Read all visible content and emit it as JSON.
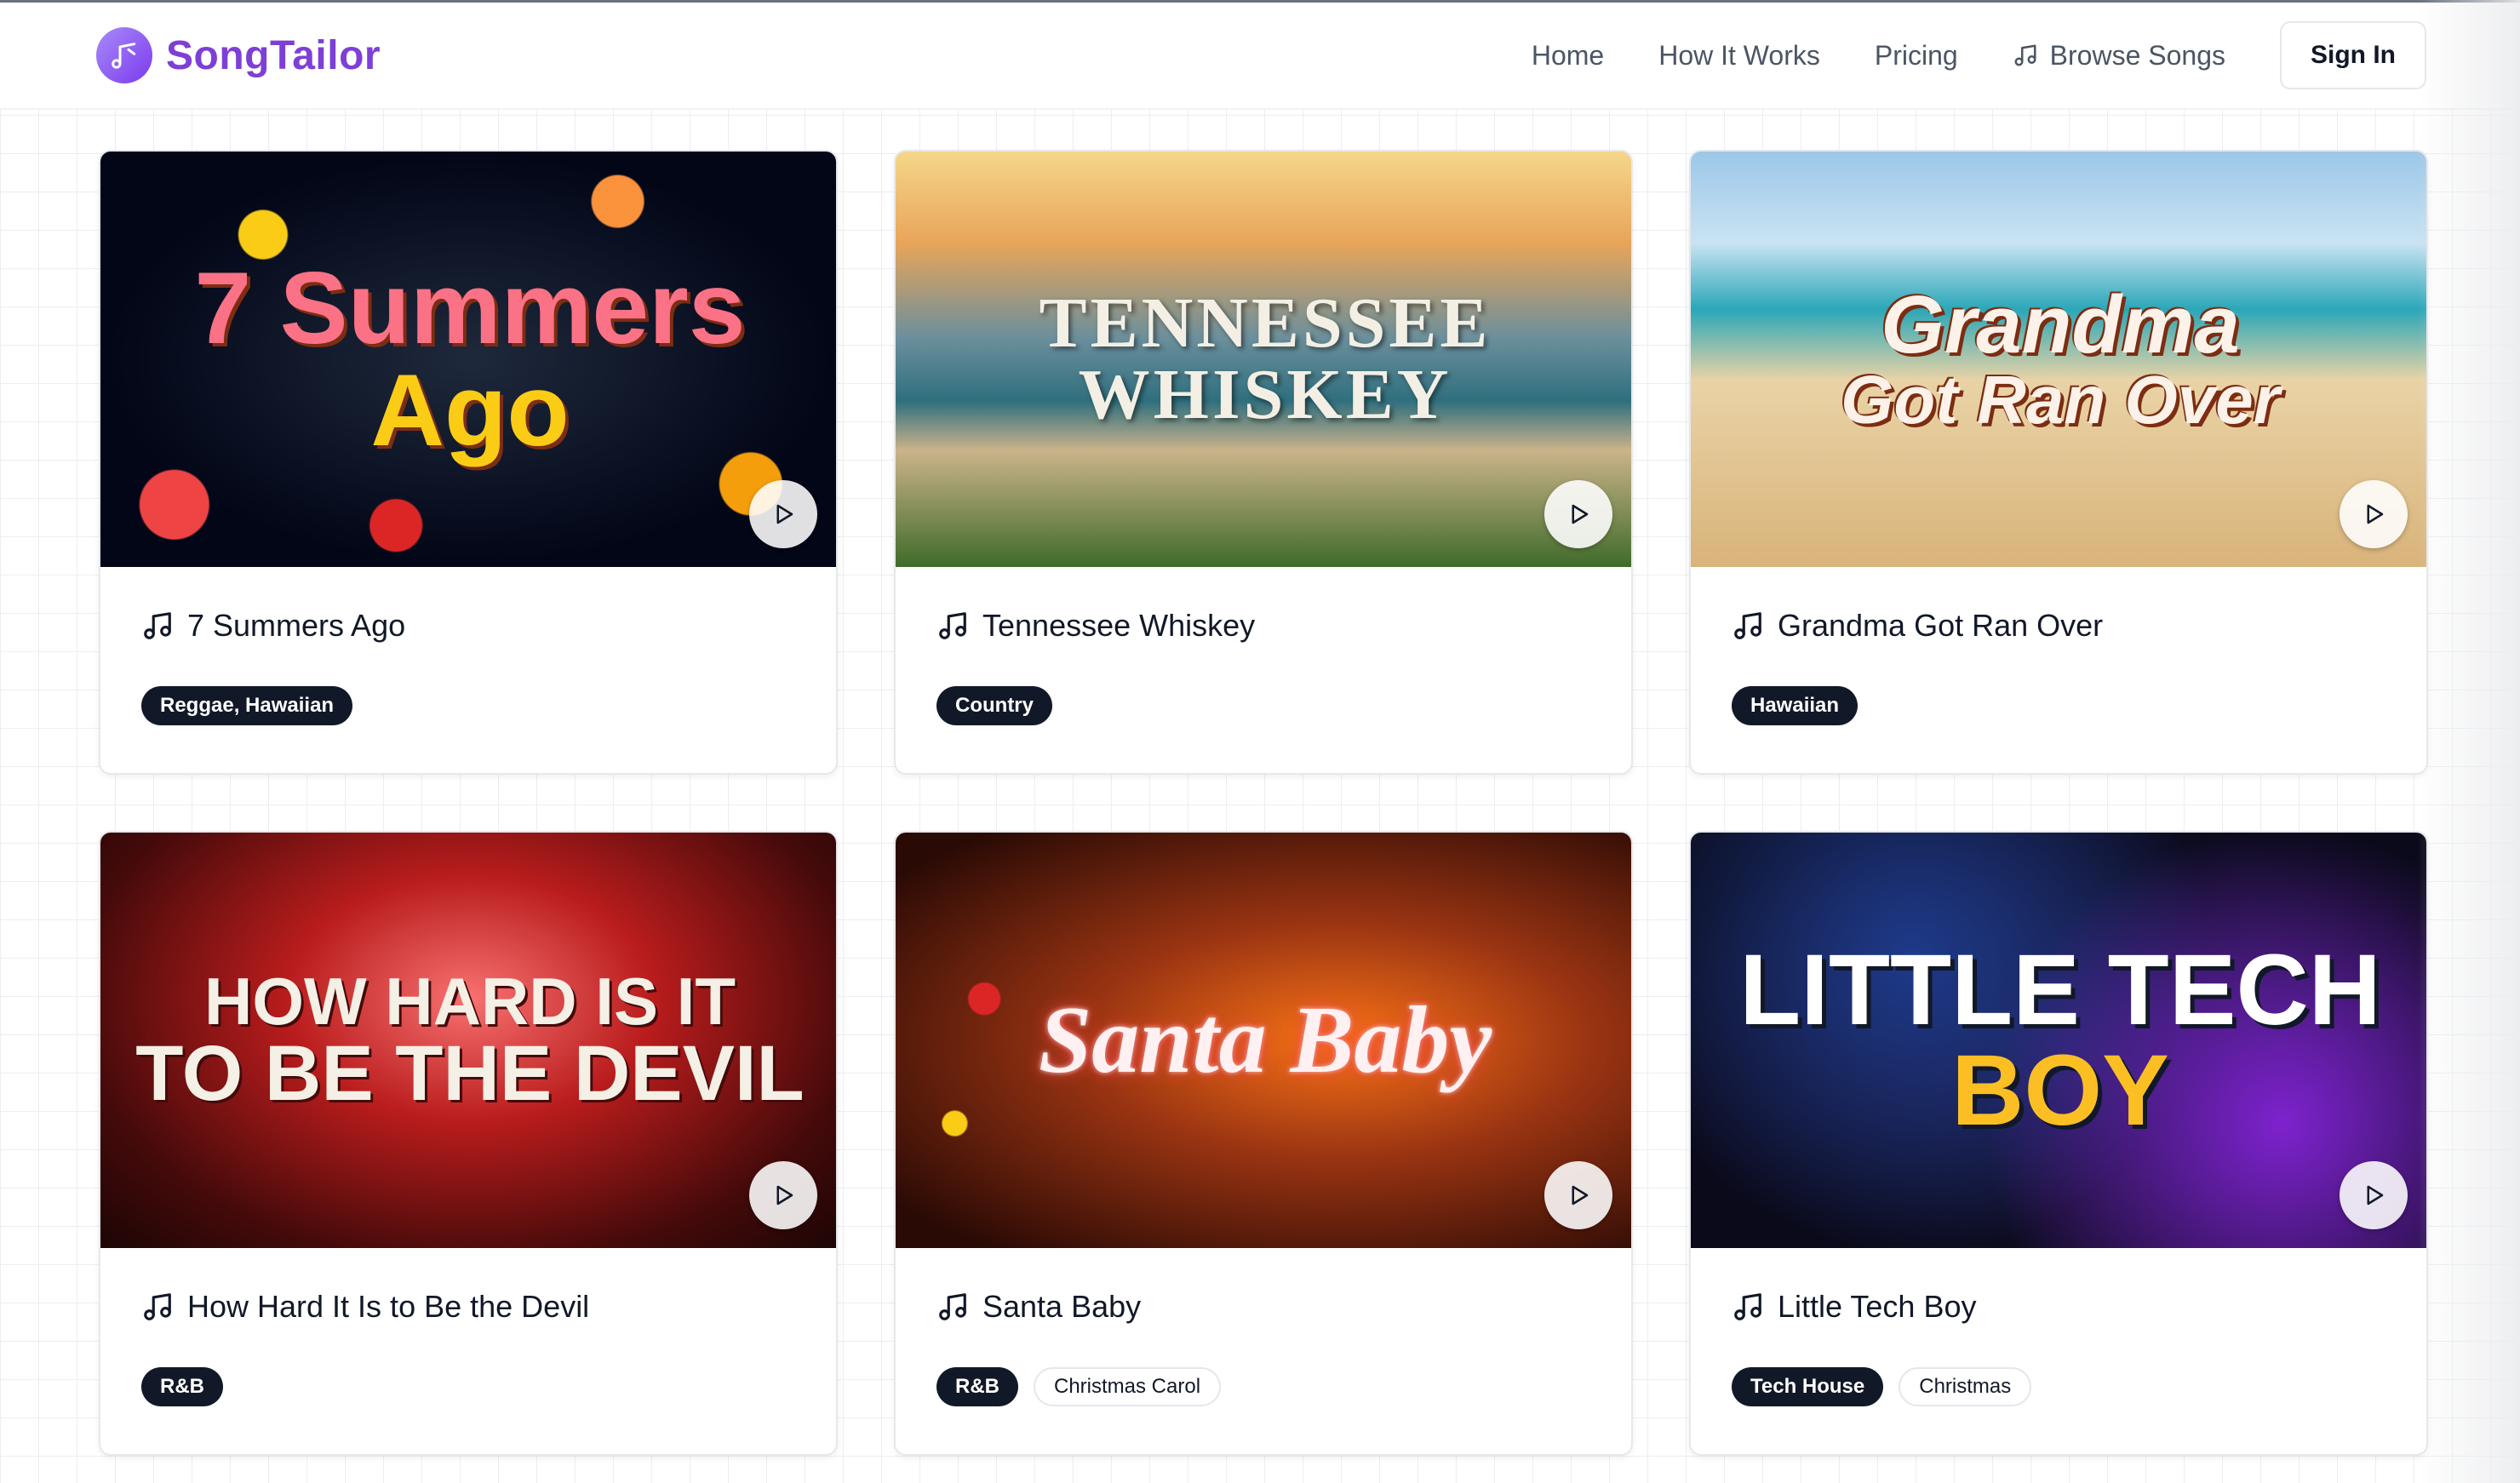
{
  "app": {
    "name": "SongTailor",
    "accent": "#7e3fd6"
  },
  "nav": {
    "items": [
      {
        "label": "Home",
        "icon": ""
      },
      {
        "label": "How It Works",
        "icon": ""
      },
      {
        "label": "Pricing",
        "icon": ""
      },
      {
        "label": "Browse Songs",
        "icon": "music-note-icon"
      }
    ],
    "sign_in_label": "Sign In"
  },
  "songs": [
    {
      "title": "7 Summers Ago",
      "cover_text_1": "7 Summers",
      "cover_text_2": "Ago",
      "tags": [
        {
          "label": "Reggae, Hawaiian",
          "style": "filled"
        }
      ]
    },
    {
      "title": "Tennessee Whiskey",
      "cover_text_1": "TENNESSEE",
      "cover_text_2": "WHISKEY",
      "tags": [
        {
          "label": "Country",
          "style": "filled"
        }
      ]
    },
    {
      "title": "Grandma Got Ran Over",
      "cover_text_1": "Grandma",
      "cover_text_2": "Got Ran Over",
      "tags": [
        {
          "label": "Hawaiian",
          "style": "filled"
        }
      ]
    },
    {
      "title": "How Hard It Is to Be the Devil",
      "cover_text_1": "HOW HARD IS IT",
      "cover_text_2": "TO BE THE DEVIL",
      "tags": [
        {
          "label": "R&B",
          "style": "filled"
        }
      ]
    },
    {
      "title": "Santa Baby",
      "cover_text_1": "Santa Baby",
      "cover_text_2": "",
      "tags": [
        {
          "label": "R&B",
          "style": "filled"
        },
        {
          "label": "Christmas Carol",
          "style": "outline"
        }
      ]
    },
    {
      "title": "Little Tech Boy",
      "cover_text_1": "LITTLE TECH",
      "cover_text_2": "BOY",
      "tags": [
        {
          "label": "Tech House",
          "style": "filled"
        },
        {
          "label": "Christmas",
          "style": "outline"
        }
      ]
    }
  ]
}
